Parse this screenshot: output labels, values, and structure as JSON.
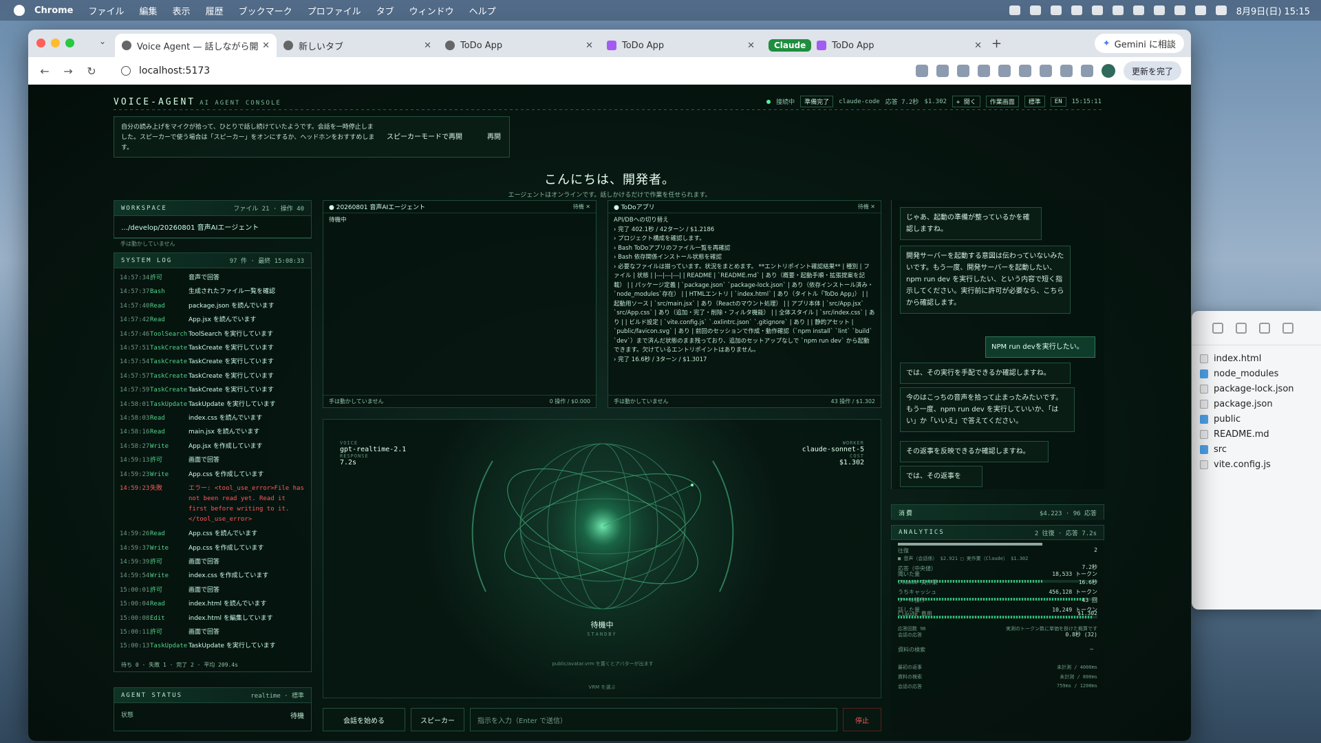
{
  "menubar": {
    "app": "Chrome",
    "items": [
      "ファイル",
      "編集",
      "表示",
      "履歴",
      "ブックマーク",
      "プロファイル",
      "タブ",
      "ウィンドウ",
      "ヘルプ"
    ],
    "clock": "8月9日(日) 15:15"
  },
  "browser": {
    "tabs": [
      {
        "title": "Voice Agent — 話しながら開発",
        "active": true,
        "icon": "globe-icon"
      },
      {
        "title": "新しいタブ",
        "active": false,
        "icon": "globe-icon"
      },
      {
        "title": "ToDo App",
        "active": false,
        "icon": "globe-icon"
      },
      {
        "title": "ToDo App",
        "active": false,
        "icon": "claude-icon"
      },
      {
        "title": "ToDo App",
        "active": false,
        "icon": "claude-icon",
        "group": "Claude"
      }
    ],
    "gemini": "Gemini に相談",
    "url": "localhost:5173",
    "update_label": "更新を完了"
  },
  "finder": {
    "items": [
      {
        "name": "index.html",
        "kind": "file"
      },
      {
        "name": "node_modules",
        "kind": "folder"
      },
      {
        "name": "package-lock.json",
        "kind": "file"
      },
      {
        "name": "package.json",
        "kind": "file"
      },
      {
        "name": "public",
        "kind": "folder"
      },
      {
        "name": "README.md",
        "kind": "file"
      },
      {
        "name": "src",
        "kind": "folder"
      },
      {
        "name": "vite.config.js",
        "kind": "file"
      }
    ]
  },
  "app": {
    "brand": "VOICE-AGENT",
    "brand_sub": "AI AGENT CONSOLE",
    "status": {
      "conn": "接続中",
      "ready": "準備完了",
      "engine": "claude-code",
      "resp": "応答 7.2秒",
      "cost": "$1.302",
      "open": "+ 開く",
      "screen": "作業画面",
      "mode": "標準",
      "lang": "EN",
      "time": "15:15:11"
    },
    "notice": {
      "text": "自分の読み上げをマイクが拾って、ひとりで話し続けていたようです。会話を一時停止しました。スピーカーで使う場合は「スピーカー」をオンにするか、ヘッドホンをおすすめします。",
      "resume_speaker": "スピーカーモードで再開",
      "resume": "再開"
    },
    "greeting": "こんにちは、開発者。",
    "subgreeting": "エージェントはオンラインです。話しかけるだけで作業を任せられます。",
    "workspace": {
      "title": "WORKSPACE",
      "meta": "ファイル 21 · 操作 40",
      "path": "…/develop/20260801 音声AIエージェント",
      "hint": "手は動かしていません"
    },
    "syslog": {
      "title": "SYSTEM LOG",
      "meta": "97 件 · 最終 15:08:33",
      "rows": [
        {
          "t": "14:57:34",
          "k": "許可",
          "m": "音声で回答"
        },
        {
          "t": "14:57:37",
          "k": "Bash",
          "m": "生成されたファイル一覧を確認"
        },
        {
          "t": "14:57:40",
          "k": "Read",
          "m": "package.json を読んでいます"
        },
        {
          "t": "14:57:42",
          "k": "Read",
          "m": "App.jsx を読んでいます"
        },
        {
          "t": "14:57:46",
          "k": "ToolSearch",
          "m": "ToolSearch を実行しています"
        },
        {
          "t": "14:57:51",
          "k": "TaskCreate",
          "m": "TaskCreate を実行しています"
        },
        {
          "t": "14:57:54",
          "k": "TaskCreate",
          "m": "TaskCreate を実行しています"
        },
        {
          "t": "14:57:57",
          "k": "TaskCreate",
          "m": "TaskCreate を実行しています"
        },
        {
          "t": "14:57:59",
          "k": "TaskCreate",
          "m": "TaskCreate を実行しています"
        },
        {
          "t": "14:58:01",
          "k": "TaskUpdate",
          "m": "TaskUpdate を実行しています"
        },
        {
          "t": "14:58:03",
          "k": "Read",
          "m": "index.css を読んでいます"
        },
        {
          "t": "14:58:16",
          "k": "Read",
          "m": "main.jsx を読んでいます"
        },
        {
          "t": "14:58:27",
          "k": "Write",
          "m": "App.jsx を作成しています"
        },
        {
          "t": "14:59:13",
          "k": "許可",
          "m": "画面で回答"
        },
        {
          "t": "14:59:23",
          "k": "Write",
          "m": "App.css を作成しています"
        },
        {
          "t": "14:59:23",
          "k": "失敗",
          "m": "エラー: <tool_use_error>File has not been read yet. Read it first before writing to it.</tool_use_error>",
          "err": true
        },
        {
          "t": "14:59:26",
          "k": "Read",
          "m": "App.css を読んでいます"
        },
        {
          "t": "14:59:37",
          "k": "Write",
          "m": "App.css を作成しています"
        },
        {
          "t": "14:59:39",
          "k": "許可",
          "m": "画面で回答"
        },
        {
          "t": "14:59:54",
          "k": "Write",
          "m": "index.css を作成しています"
        },
        {
          "t": "15:00:01",
          "k": "許可",
          "m": "画面で回答"
        },
        {
          "t": "15:00:04",
          "k": "Read",
          "m": "index.html を読んでいます"
        },
        {
          "t": "15:00:08",
          "k": "Edit",
          "m": "index.html を編集しています"
        },
        {
          "t": "15:00:11",
          "k": "許可",
          "m": "画面で回答"
        },
        {
          "t": "15:00:13",
          "k": "TaskUpdate",
          "m": "TaskUpdate を実行しています"
        }
      ],
      "footer": "待ち 0 · 失敗 1 · 完了 2 · 平均 209.4s"
    },
    "agent_status": {
      "title": "AGENT STATUS",
      "meta": "realtime · 標準",
      "label": "状態",
      "value": "待機"
    },
    "session1": {
      "title": "20260801 音声AIエージェント",
      "state": "待機",
      "body": "待機中",
      "foot_left": "手は動かしていません",
      "foot_right": "0 操作 / $0.000"
    },
    "session2": {
      "title": "ToDoアプリ",
      "state": "待機",
      "lines": [
        "API/DBへの切り替え",
        "› 完了 402.1秒 / 42ターン / $1.2186",
        "› プロジェクト構成を確認します。",
        "› Bash ToDoアプリのファイル一覧を再確認",
        "› Bash 依存関係インストール状態を確認",
        "› 必要なファイルは揃っています。状況をまとめます。 **エントリポイント確認結果** | 種別 | ファイル | 状態 | |---|---|---| | README | `README.md` | あり（概要・起動手順・拡張提案を記載） | | パッケージ定義 | `package.json` `package-lock.json` | あり（依存インストール済み・`node_modules`存在） | | HTMLエントリ | `index.html` | あり（タイトル「ToDo App」） | | 起動用ソース | `src/main.jsx` | あり（Reactのマウント処理） | | アプリ本体 | `src/App.jsx` `src/App.css` | あり（追加・完了・削除・フィルタ機能） | | 全体スタイル | `src/index.css` | あり | | ビルド設定 | `vite.config.js` `.oxlintrc.json` `.gitignore` | あり | | 静的アセット | `public/favicon.svg` | あり | 前回のセッションで作成・動作確認（`npm install` `lint` `build` `dev`）まで済んだ状態のまま残っており、追加のセットアップなしで `npm run dev` から起動できます。欠けているエントリポイントはありません。",
        "› 完了 16.6秒 / 3ターン / $1.3017"
      ],
      "foot_left": "手は動かしていません",
      "foot_right": "43 操作 / $1.302"
    },
    "stage": {
      "voice_cap": "VOICE",
      "voice": "gpt-realtime-2.1",
      "resp_cap": "RESPONSE",
      "resp": "7.2s",
      "worker_cap": "WORKER",
      "worker": "claude-sonnet-5",
      "cost_cap": "COST",
      "cost": "$1.302",
      "status": "待機中",
      "status_en": "STANDBY",
      "hint": "public/avatar.vrm を置くとアバターが出ます",
      "vrm": "VRM を選ぶ"
    },
    "controls": {
      "start": "会話を始める",
      "speaker": "スピーカー",
      "placeholder": "指示を入力（Enter で送信）",
      "stop": "停止"
    },
    "chat": [
      {
        "role": "agent",
        "text": "じゃあ、起動の準備が整っているかを確認しますね。"
      },
      {
        "role": "agent",
        "text": "開発サーバーを起動する意図は伝わっていないみたいです。もう一度、開発サーバーを起動したい、npm run dev を実行したい、という内容で短く指示してください。実行前に許可が必要なら、こちらから確認します。"
      },
      {
        "role": "user",
        "text": "NPM run devを実行したい。"
      },
      {
        "role": "agent",
        "text": "では、その実行を手配できるか確認しますね。"
      },
      {
        "role": "agent",
        "text": "今のはこっちの音声を拾って止まったみたいです。もう一度、npm run dev を実行していいか、「はい」か「いいえ」で答えてください。"
      },
      {
        "role": "agent",
        "text": "その返事を反映できるか確認しますね。"
      },
      {
        "role": "agent",
        "text": "では、その返事を"
      }
    ],
    "cost": {
      "title": "消費",
      "value": "$4.223 · 96 応答"
    },
    "analytics": {
      "title": "ANALYTICS",
      "meta": "2 往復 · 応答 7.2s",
      "rt_label": "往復",
      "rt_value": "2",
      "legend": "■ 音声（会話係） $2.921  □ 実作業（Claude） $1.302",
      "resp_mid_label": "応答（中央値）",
      "resp_mid": "7.2秒",
      "heard_label": "聞いた量",
      "heard": "18,533 トークン",
      "work_label": "Claude 実作業",
      "work": "16.6秒",
      "cache_label": "うちキャッシュ",
      "cache": "456,128 トークン",
      "ops_label": "ツール操作",
      "ops": "43 回",
      "said_label": "話した量",
      "said": "10,249 トークン",
      "cc_label": "Claude 費用",
      "cc": "$1.302",
      "count_label": "応答回数 96",
      "count_note": "実測のトークン数に単価を掛けた概算です",
      "first_label": "会話の応答",
      "first_value": "0.8秒 (32)",
      "search1_label": "資料の検索",
      "search1_value": "—",
      "first_reply_label": "最初の返事",
      "first_reply_value": "未計測 / 4000ms",
      "search2_label": "資料の検索",
      "search2_value": "未計測 / 800ms",
      "conv_label": "会話の応答",
      "conv_value": "759ms / 1200ms"
    }
  }
}
